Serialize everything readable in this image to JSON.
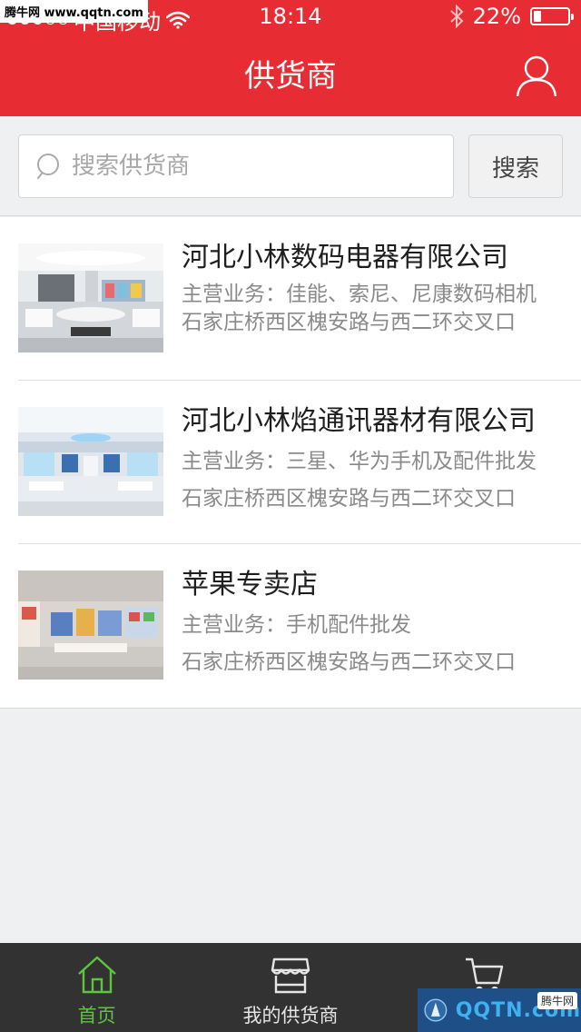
{
  "watermark": {
    "top_left": "腾牛网 www.qqtn.com",
    "bottom_right_logo": "QQTN.com",
    "bottom_right_badge": "腾牛网"
  },
  "status_bar": {
    "carrier": "中国移动",
    "time": "18:14",
    "battery_text": "22%",
    "battery_level": 0.22,
    "icons": [
      "signal-dots-icon",
      "wifi-icon",
      "bluetooth-icon",
      "battery-icon"
    ]
  },
  "nav": {
    "title": "供货商",
    "right_icon": "user-icon"
  },
  "search": {
    "placeholder": "搜索供货商",
    "value": "",
    "button_label": "搜索",
    "icon": "search-icon"
  },
  "suppliers": [
    {
      "name": "河北小林数码电器有限公司",
      "business": "主营业务：佳能、索尼、尼康数码相机",
      "address": "石家庄桥西区槐安路与西二环交叉口"
    },
    {
      "name": "河北小林焰通讯器材有限公司",
      "business": "主营业务：三星、华为手机及配件批发",
      "address": "石家庄桥西区槐安路与西二环交叉口"
    },
    {
      "name": "苹果专卖店",
      "business": "主营业务：手机配件批发",
      "address": "石家庄桥西区槐安路与西二环交叉口"
    }
  ],
  "tabbar": {
    "tabs": [
      {
        "label": "首页",
        "icon": "home-icon",
        "active": true
      },
      {
        "label": "我的供货商",
        "icon": "store-icon",
        "active": false
      },
      {
        "label": "",
        "icon": "cart-icon",
        "active": false
      }
    ]
  },
  "colors": {
    "brand_red": "#e72d33",
    "tab_active_green": "#5cc63e",
    "tabbar_bg": "#323232",
    "page_bg": "#eef0f2"
  }
}
